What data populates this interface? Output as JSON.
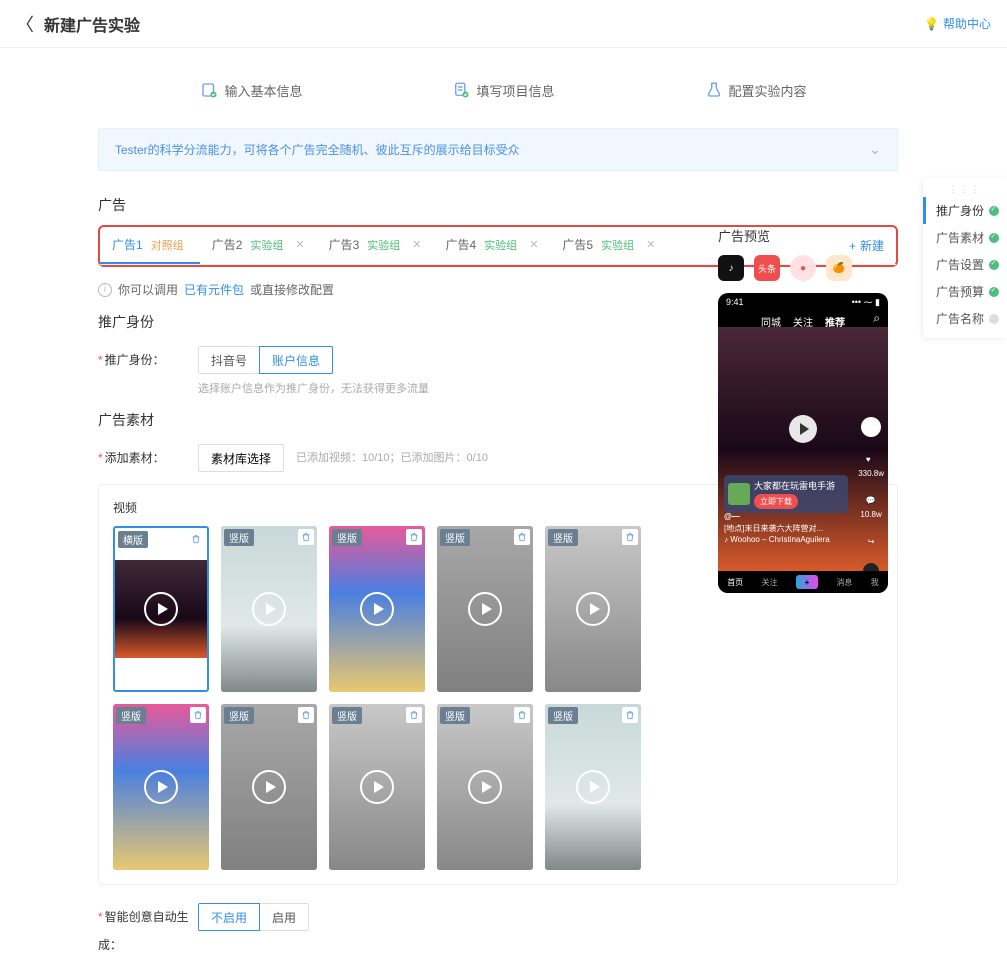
{
  "header": {
    "title": "新建广告实验",
    "help": "帮助中心"
  },
  "steps": [
    "输入基本信息",
    "填写项目信息",
    "配置实验内容"
  ],
  "banner": "Tester的科学分流能力，可将各个广告完全随机、彼此互斥的展示给目标受众",
  "section": {
    "ads": "广告",
    "preview": "广告预览"
  },
  "tabs": [
    {
      "name": "广告1",
      "badge": "对照组",
      "kind": "control",
      "closable": false,
      "active": true
    },
    {
      "name": "广告2",
      "badge": "实验组",
      "kind": "exp",
      "closable": true
    },
    {
      "name": "广告3",
      "badge": "实验组",
      "kind": "exp",
      "closable": true
    },
    {
      "name": "广告4",
      "badge": "实验组",
      "kind": "exp",
      "closable": true
    },
    {
      "name": "广告5",
      "badge": "实验组",
      "kind": "exp",
      "closable": true
    }
  ],
  "newtab": "新建",
  "hint": {
    "prefix": "你可以调用",
    "link": "已有元件包",
    "suffix": "或直接修改配置"
  },
  "identity": {
    "title": "推广身份",
    "label": "推广身份：",
    "options": [
      "抖音号",
      "账户信息"
    ],
    "selected": 1,
    "help": "选择账户信息作为推广身份，无法获得更多流量"
  },
  "material": {
    "title": "广告素材",
    "label": "添加素材：",
    "button": "素材库选择",
    "counts": "已添加视频：10/10；已添加图片：0/10",
    "panel_title": "视频"
  },
  "videos": [
    {
      "orient": "横版",
      "bg": "dark",
      "first": true
    },
    {
      "orient": "竖版",
      "bg": "car"
    },
    {
      "orient": "竖版",
      "bg": "city"
    },
    {
      "orient": "竖版",
      "bg": "street"
    },
    {
      "orient": "竖版",
      "bg": "hand"
    },
    {
      "orient": "竖版",
      "bg": "city"
    },
    {
      "orient": "竖版",
      "bg": "street"
    },
    {
      "orient": "竖版",
      "bg": "hand"
    },
    {
      "orient": "竖版",
      "bg": "hand"
    },
    {
      "orient": "竖版",
      "bg": "car"
    }
  ],
  "smart": {
    "label": "智能创意自动生成：",
    "options": [
      "不启用",
      "启用"
    ],
    "selected": 0
  },
  "phone": {
    "time": "9:41",
    "tabs": [
      "同城",
      "关注",
      "推荐"
    ],
    "promo_text": "大家都在玩雷电手游",
    "download": "立即下载",
    "at": "@—",
    "caption": "[地点]末日来袭六大阵营对...",
    "music": "♪ Woohoo – ChristinaAguilera",
    "rail": [
      "",
      "330.8w",
      "10.8w",
      "",
      ""
    ],
    "bottom": [
      "首页",
      "关注",
      "+",
      "消息",
      "我"
    ]
  },
  "sidenav": [
    {
      "label": "推广身份",
      "done": true,
      "active": true
    },
    {
      "label": "广告素材",
      "done": true
    },
    {
      "label": "广告设置",
      "done": true
    },
    {
      "label": "广告预算",
      "done": true
    },
    {
      "label": "广告名称",
      "done": false
    }
  ]
}
